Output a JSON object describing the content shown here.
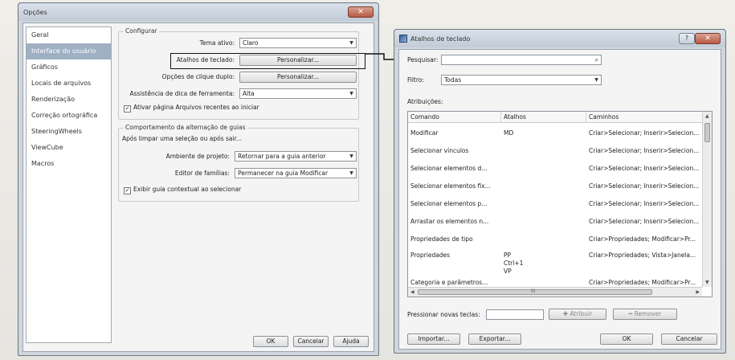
{
  "opcoes": {
    "title": "Opções",
    "close_glyph": "✕",
    "nav_items": [
      "Geral",
      "Interface do usuário",
      "Gráficos",
      "Locais de arquivos",
      "Renderização",
      "Correção ortográfica",
      "SteeringWheels",
      "ViewCube",
      "Macros"
    ],
    "selected_nav": "Interface do usuário",
    "configurar": {
      "group_title": "Configurar",
      "tema_label": "Tema ativo:",
      "tema_value": "Claro",
      "atalhos_label": "Atalhos de teclado:",
      "atalhos_button": "Personalizar...",
      "clique_label": "Opções de clique duplo:",
      "clique_button": "Personalizar...",
      "dica_label": "Assistência de dica de ferramenta:",
      "dica_value": "Alta",
      "recentes_check": "Ativar página Arquivos recentes ao iniciar"
    },
    "guias": {
      "group_title": "Comportamento da alternação de guias",
      "subtitle": "Após limpar uma seleção ou após sair...",
      "projeto_label": "Ambiente de projeto:",
      "projeto_value": "Retornar para a guia anterior",
      "familias_label": "Editor de famílias:",
      "familias_value": "Permanecer na guia Modificar",
      "contextual_check": "Exibir guia contextual ao selecionar"
    },
    "buttons": {
      "ok": "OK",
      "cancelar": "Cancelar",
      "ajuda": "Ajuda"
    }
  },
  "atalhos": {
    "title": "Atalhos de teclado",
    "help_glyph": "?",
    "close_glyph": "✕",
    "pesquisar_label": "Pesquisar:",
    "pesquisar_value": "",
    "filtro_label": "Filtro:",
    "filtro_value": "Todas",
    "atribuicoes_label": "Atribuições:",
    "columns": [
      "Comando",
      "Atalhos",
      "Caminhos"
    ],
    "rows": [
      {
        "comando": "Modificar",
        "atalhos": "MD",
        "caminhos": "Criar>Selecionar; Inserir>Selecion..."
      },
      {
        "comando": "Selecionar vínculos",
        "atalhos": "",
        "caminhos": "Criar>Selecionar; Inserir>Selecion..."
      },
      {
        "comando": "Selecionar elementos d...",
        "atalhos": "",
        "caminhos": "Criar>Selecionar; Inserir>Selecion..."
      },
      {
        "comando": "Selecionar elementos fix...",
        "atalhos": "",
        "caminhos": "Criar>Selecionar; Inserir>Selecion..."
      },
      {
        "comando": "Selecionar elementos p...",
        "atalhos": "",
        "caminhos": "Criar>Selecionar; Inserir>Selecion..."
      },
      {
        "comando": "Arrastar os elementos n...",
        "atalhos": "",
        "caminhos": "Criar>Selecionar; Inserir>Selecion..."
      },
      {
        "comando": "Propriedades de tipo",
        "atalhos": "",
        "caminhos": "Criar>Propriedades; Modificar>Pr..."
      },
      {
        "comando": "Propriedades",
        "atalhos": "PP\nCtrl+1\nVP",
        "caminhos": "Criar>Propriedades; Vista>Janela..."
      },
      {
        "comando": "Categoria e parâmetros...",
        "atalhos": "",
        "caminhos": "Criar>Propriedades; Modificar>Pr..."
      }
    ],
    "scroll_glyph": "III",
    "nova_tecla_label": "Pressionar novas teclas:",
    "atribuir_button": "Atribuir",
    "remover_button": "Remover",
    "importar_button": "Importar...",
    "exportar_button": "Exportar...",
    "ok_button": "OK",
    "cancelar_button": "Cancelar"
  }
}
